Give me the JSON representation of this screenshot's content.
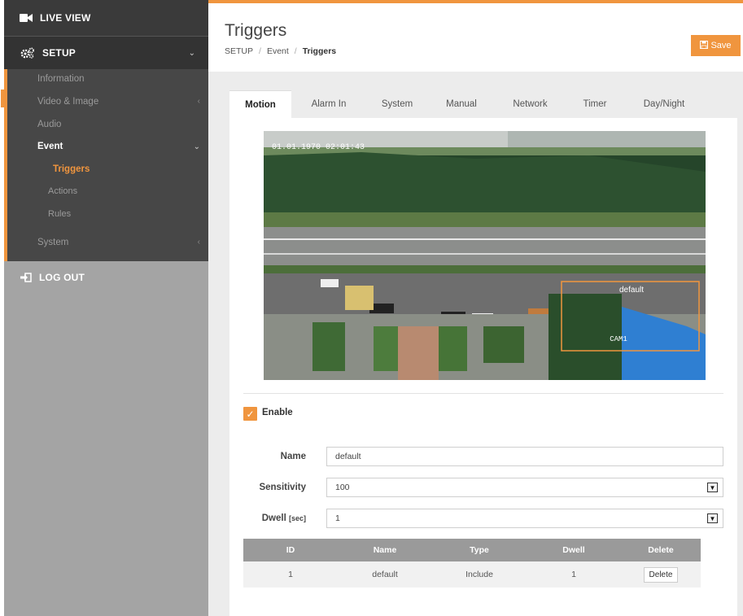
{
  "sidebar": {
    "live_view": "LIVE VIEW",
    "setup": "SETUP",
    "items": [
      {
        "label": "Information"
      },
      {
        "label": "Video & Image"
      },
      {
        "label": "Audio"
      },
      {
        "label": "Event"
      },
      {
        "label": "Triggers"
      },
      {
        "label": "Actions"
      },
      {
        "label": "Rules"
      },
      {
        "label": "System"
      }
    ],
    "logout": "LOG OUT"
  },
  "header": {
    "title": "Triggers",
    "breadcrumb": [
      "SETUP",
      "Event",
      "Triggers"
    ],
    "save_label": "Save"
  },
  "tabs": [
    "Motion",
    "Alarm In",
    "System",
    "Manual",
    "Network",
    "Timer",
    "Day/Night"
  ],
  "video": {
    "timestamp": "01.01.1970 02:01:43",
    "zone_label": "default",
    "cam_label": "CAM1"
  },
  "form": {
    "enable_label": "Enable",
    "name_label": "Name",
    "name_value": "default",
    "sensitivity_label": "Sensitivity",
    "sensitivity_value": "100",
    "dwell_label": "Dwell",
    "dwell_unit": "[sec]",
    "dwell_value": "1"
  },
  "table": {
    "headers": [
      "ID",
      "Name",
      "Type",
      "Dwell",
      "Delete"
    ],
    "rows": [
      {
        "id": "1",
        "name": "default",
        "type": "Include",
        "dwell": "1",
        "delete": "Delete"
      }
    ]
  },
  "colors": {
    "accent": "#f0953e",
    "sidebar_dark": "#444444",
    "sidebar_light": "#a4a4a4"
  }
}
